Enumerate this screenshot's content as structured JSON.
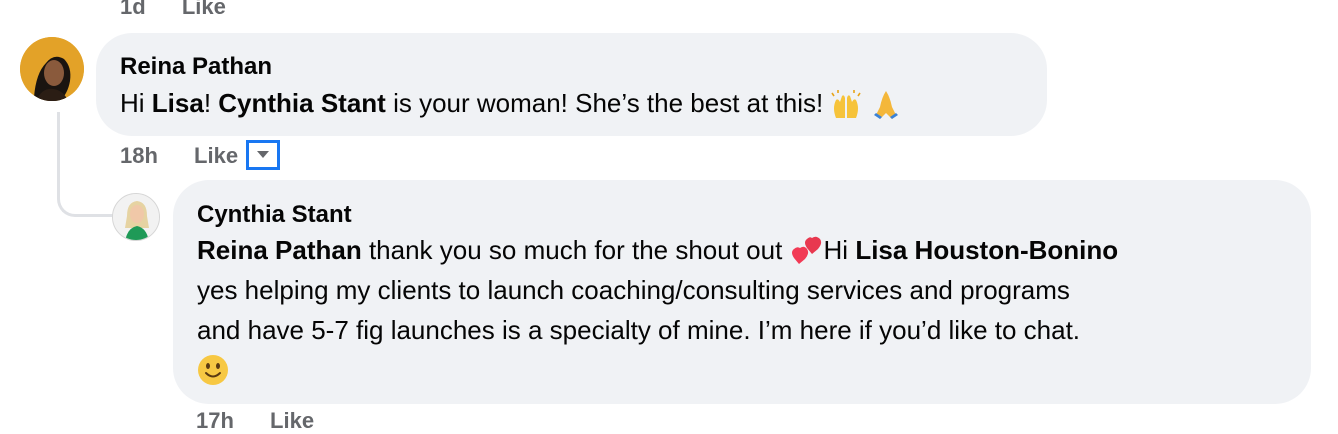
{
  "top_meta": {
    "time": "1d",
    "like": "Like"
  },
  "comment1": {
    "author": "Reina Pathan",
    "text_pre": "Hi ",
    "mention1": "Lisa",
    "text_mid": "! ",
    "mention2": "Cynthia Stant",
    "text_post": " is your woman! She’s the best at this! ",
    "emoji_icons": [
      "raising-hands-icon",
      "folded-hands-icon"
    ],
    "time": "18h",
    "like": "Like"
  },
  "reply": {
    "author": "Cynthia Stant",
    "mention1": "Reina Pathan",
    "text1": " thank you so much for the shout out ",
    "heart_icon": "two-hearts-icon",
    "text2": "Hi ",
    "mention2": "Lisa Houston-Bonino",
    "line2": "yes helping my clients to launch coaching/consulting services and programs",
    "line3": "and have 5-7 fig launches is a specialty of mine. I’m here if you’d like to chat.",
    "smile_icon": "smiling-face-icon",
    "time": "17h",
    "like": "Like"
  },
  "colors": {
    "bubble": "#f0f2f5",
    "meta": "#65676b",
    "focus": "#1877f2"
  }
}
